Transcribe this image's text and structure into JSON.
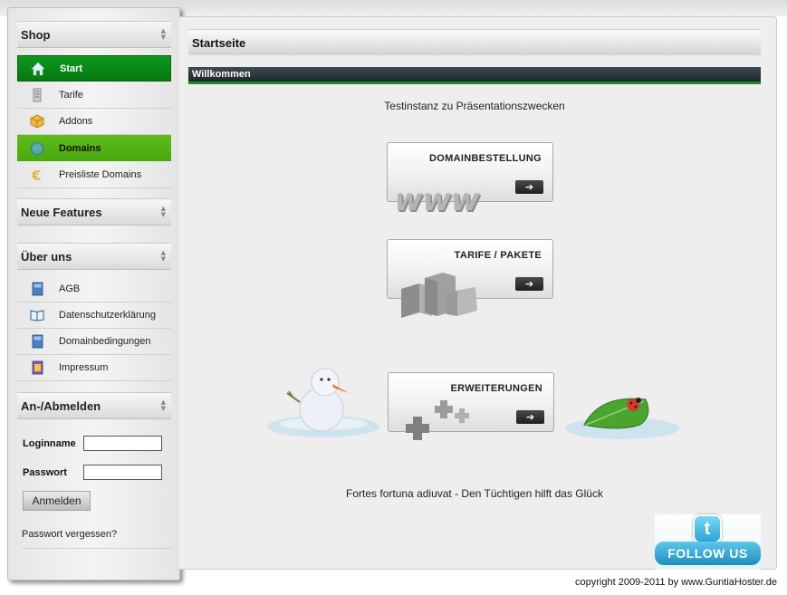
{
  "sidebar": {
    "shop": {
      "title": "Shop",
      "items": [
        {
          "label": "Start",
          "icon": "home-icon"
        },
        {
          "label": "Tarife",
          "icon": "server-icon"
        },
        {
          "label": "Addons",
          "icon": "box-icon"
        },
        {
          "label": "Domains",
          "icon": "globe-icon"
        },
        {
          "label": "Preisliste Domains",
          "icon": "euro-icon"
        }
      ]
    },
    "features": {
      "title": "Neue Features"
    },
    "about": {
      "title": "Über uns",
      "items": [
        {
          "label": "AGB",
          "icon": "book-icon"
        },
        {
          "label": "Datenschutzerklärung",
          "icon": "open-book-icon"
        },
        {
          "label": "Domainbedingungen",
          "icon": "book-icon"
        },
        {
          "label": "Impressum",
          "icon": "address-book-icon"
        }
      ]
    },
    "login": {
      "title": "An-/Abmelden",
      "username_label": "Loginname",
      "username_value": "",
      "password_label": "Passwort",
      "password_value": "",
      "button": "Anmelden",
      "forgot": "Passwort vergessen?"
    }
  },
  "main": {
    "page_title": "Startseite",
    "welcome": "Willkommen",
    "intro": "Testinstanz zu Präsentationszwecken",
    "features": [
      {
        "label": "DOMAINBESTELLUNG",
        "icon": "www-icon"
      },
      {
        "label": "TARIFE / PAKETE",
        "icon": "cubes-icon"
      },
      {
        "label": "ERWEITERUNGEN",
        "icon": "plus-icon"
      }
    ],
    "motto": "Fortes fortuna adiuvat - Den Tüchtigen hilft das Glück",
    "twitter": "FOLLOW US"
  },
  "footer": {
    "copyright": "copyright 2009-2011 by www.GuntiaHoster.de"
  },
  "colors": {
    "active_green": "#0d9a1e",
    "selected_green": "#5fbb1a",
    "welcome_bar": "#2b353c"
  }
}
